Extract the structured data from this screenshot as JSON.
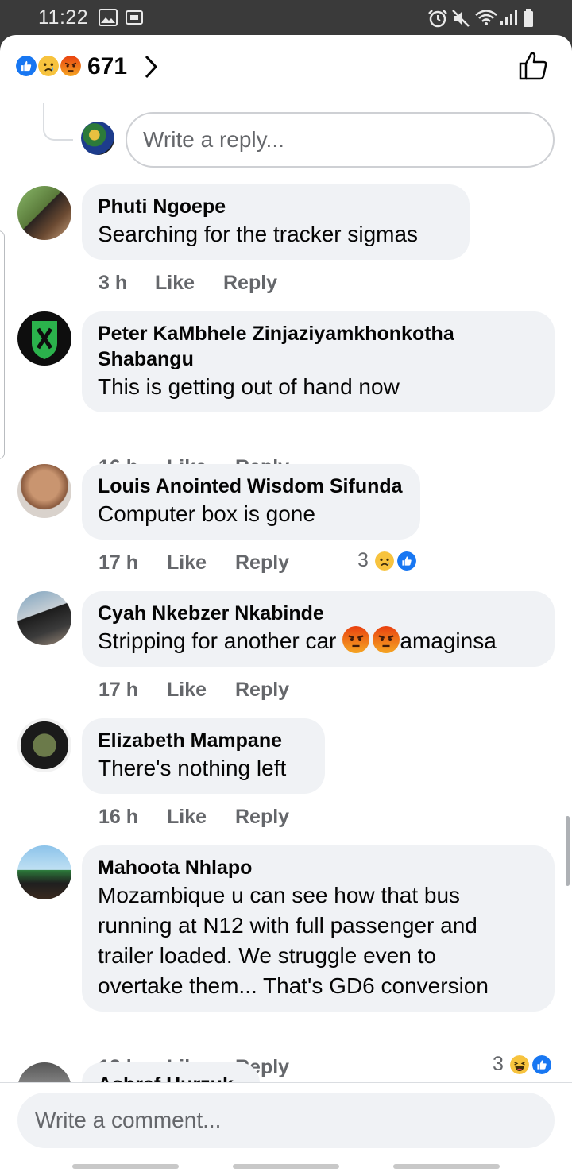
{
  "status_bar": {
    "time": "11:22"
  },
  "reactions": {
    "count": "671"
  },
  "reply_box": {
    "placeholder": "Write a reply..."
  },
  "comments": [
    {
      "author": "Phuti Ngoepe",
      "lines": [
        "Searching for the tracker sigmas"
      ],
      "time": "3 h",
      "like": "Like",
      "reply": "Reply"
    },
    {
      "author": "Peter KaMbhele Zinjaziyamkhonkotha Shabangu",
      "author_lines": [
        "Peter KaMbhele Zinjaziyamkhonkotha",
        "Shabangu"
      ],
      "lines": [
        "This is getting out of hand now"
      ],
      "time": "16 h",
      "like": "Like",
      "reply": "Reply"
    },
    {
      "author": "Louis Anointed Wisdom Sifunda",
      "lines": [
        "Computer box is gone"
      ],
      "time": "17 h",
      "like": "Like",
      "reply": "Reply",
      "reaction_count": "3"
    },
    {
      "author": "Cyah Nkebzer Nkabinde",
      "lines": [
        "Stripping for another car",
        "amaginsa"
      ],
      "time": "17 h",
      "like": "Like",
      "reply": "Reply"
    },
    {
      "author": "Elizabeth Mampane",
      "lines": [
        "There's nothing left"
      ],
      "time": "16 h",
      "like": "Like",
      "reply": "Reply"
    },
    {
      "author": "Mahoota Nhlapo",
      "lines": [
        "Mozambique u can see how that bus",
        "running at N12 with full passenger and",
        "trailer loaded. We struggle even to",
        "overtake them... That's GD6  conversion"
      ],
      "time": "12 h",
      "like": "Like",
      "reply": "Reply",
      "reaction_count": "3"
    },
    {
      "author": "Ashraf Hurzuk"
    }
  ],
  "composer": {
    "placeholder": "Write a comment..."
  },
  "icons": {
    "like_reaction": "like-icon",
    "sad_reaction": "sad-icon",
    "angry_reaction": "angry-icon",
    "haha_reaction": "haha-icon",
    "thumbs_up": "thumbs-up-icon",
    "chevron": "chevron-right-icon"
  },
  "colors": {
    "like_blue": "#1877f2",
    "emoji_yellow": "#f7c33e",
    "angry_red": "#e9710f",
    "bubble_bg": "#f0f2f5",
    "meta_gray": "#65676b"
  }
}
